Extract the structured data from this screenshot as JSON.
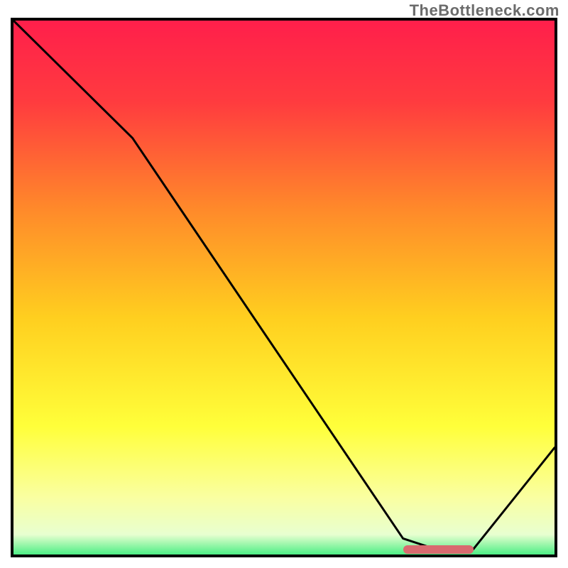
{
  "watermark": "TheBottleneck.com",
  "chart_data": {
    "type": "line",
    "title": "",
    "xlabel": "",
    "ylabel": "",
    "xlim": [
      0,
      100
    ],
    "ylim": [
      0,
      100
    ],
    "x": [
      0,
      22,
      72,
      78,
      85,
      100
    ],
    "values": [
      100,
      78,
      3,
      1,
      1,
      20
    ],
    "gradient_stops": [
      {
        "pos": 0.0,
        "color": "#ff1f4b"
      },
      {
        "pos": 0.15,
        "color": "#ff3b3f"
      },
      {
        "pos": 0.35,
        "color": "#ff8a2a"
      },
      {
        "pos": 0.55,
        "color": "#ffcf1f"
      },
      {
        "pos": 0.75,
        "color": "#ffff3a"
      },
      {
        "pos": 0.88,
        "color": "#faffa0"
      },
      {
        "pos": 0.95,
        "color": "#e8ffd0"
      },
      {
        "pos": 1.0,
        "color": "#17e86a"
      }
    ],
    "marker": {
      "x_start": 72,
      "x_end": 85,
      "y": 1,
      "color": "#d96a6f"
    }
  }
}
